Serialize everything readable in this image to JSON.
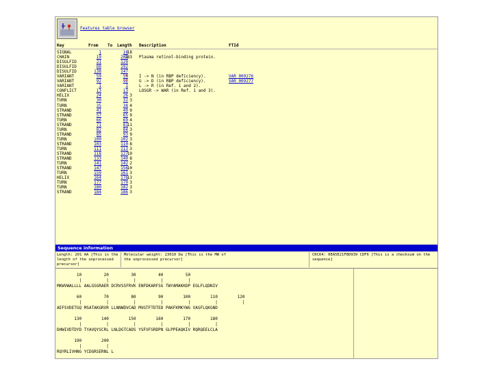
{
  "logo_link": "Features table browser",
  "feature_table": {
    "headers": {
      "key": "Key",
      "from": "From",
      "to": "To",
      "length": "Length",
      "description": "Description",
      "fid": "FTId"
    },
    "rows": [
      {
        "key": "SIGNAL",
        "from": "1",
        "to": "18",
        "length": "18",
        "star": "",
        "desc": "",
        "fid": ""
      },
      {
        "key": "CHAIN",
        "from": "19",
        "to": "201",
        "length": "183",
        "star": "",
        "desc": "Plasma retinol-binding protein.",
        "fid": ""
      },
      {
        "key": "DISULFID",
        "from": "21",
        "to": "129",
        "length": "",
        "star": "",
        "desc": "",
        "fid": ""
      },
      {
        "key": "DISULFID",
        "from": "88",
        "to": "192",
        "length": "",
        "star": "",
        "desc": "",
        "fid": ""
      },
      {
        "key": "DISULFID",
        "from": "138",
        "to": "147",
        "length": "",
        "star": "",
        "desc": "",
        "fid": ""
      },
      {
        "key": "VARIANT",
        "from": "59",
        "to": "59",
        "length": "",
        "star": "*",
        "desc": "I -> N (in RBP deficiency).",
        "fid": "VAR_009276"
      },
      {
        "key": "VARIANT",
        "from": "92",
        "to": "92",
        "length": "",
        "star": "*",
        "desc": "G -> D (in RBP deficiency).",
        "fid": "VAR_009277"
      },
      {
        "key": "VARIANT",
        "from": "1",
        "to": "1",
        "length": "",
        "star": "",
        "desc": "L -> R (in Ref. 1 and 2).",
        "fid": ""
      },
      {
        "key": "CONFLICT",
        "from": "13",
        "to": "13",
        "length": "",
        "star": "",
        "desc": "LOSGR -> WAR (in Ref. 1 and 3).",
        "fid": ""
      },
      {
        "key": "HELIX",
        "from": "24",
        "to": "26",
        "length": "3",
        "star": "",
        "desc": "",
        "fid": ""
      },
      {
        "key": "TURN",
        "from": "30",
        "to": "32",
        "length": "3",
        "star": "",
        "desc": "",
        "fid": ""
      },
      {
        "key": "TURN",
        "from": "35",
        "to": "38",
        "length": "4",
        "star": "",
        "desc": "",
        "fid": ""
      },
      {
        "key": "STRAND",
        "from": "41",
        "to": "49",
        "length": "9",
        "star": "",
        "desc": "",
        "fid": ""
      },
      {
        "key": "STRAND",
        "from": "57",
        "to": "65",
        "length": "9",
        "star": "",
        "desc": "",
        "fid": ""
      },
      {
        "key": "TURN",
        "from": "66",
        "to": "69",
        "length": "4",
        "star": "",
        "desc": "",
        "fid": ""
      },
      {
        "key": "STRAND",
        "from": "71",
        "to": "81",
        "length": "11",
        "star": "",
        "desc": "",
        "fid": ""
      },
      {
        "key": "TURN",
        "from": "82",
        "to": "84",
        "length": "3",
        "star": "",
        "desc": "",
        "fid": ""
      },
      {
        "key": "STRAND",
        "from": "85",
        "to": "93",
        "length": "9",
        "star": "",
        "desc": "",
        "fid": ""
      },
      {
        "key": "TURN",
        "from": "100",
        "to": "102",
        "length": "3",
        "star": "",
        "desc": "",
        "fid": ""
      },
      {
        "key": "STRAND",
        "from": "103",
        "to": "110",
        "length": "8",
        "star": "",
        "desc": "",
        "fid": ""
      },
      {
        "key": "TURN",
        "from": "111",
        "to": "113",
        "length": "3",
        "star": "",
        "desc": "",
        "fid": ""
      },
      {
        "key": "STRAND",
        "from": "118",
        "to": "127",
        "length": "10",
        "star": "",
        "desc": "",
        "fid": ""
      },
      {
        "key": "STRAND",
        "from": "133",
        "to": "140",
        "length": "8",
        "star": "",
        "desc": "",
        "fid": ""
      },
      {
        "key": "TURN",
        "from": "141",
        "to": "142",
        "length": "2",
        "star": "",
        "desc": "",
        "fid": ""
      },
      {
        "key": "STRAND",
        "from": "147",
        "to": "156",
        "length": "10",
        "star": "",
        "desc": "",
        "fid": ""
      },
      {
        "key": "TURN",
        "from": "159",
        "to": "161",
        "length": "3",
        "star": "",
        "desc": "",
        "fid": ""
      },
      {
        "key": "HELIX",
        "from": "164",
        "to": "176",
        "length": "13",
        "star": "",
        "desc": "",
        "fid": ""
      },
      {
        "key": "TURN",
        "from": "177",
        "to": "179",
        "length": "3",
        "star": "",
        "desc": "",
        "fid": ""
      },
      {
        "key": "TURN",
        "from": "180",
        "to": "182",
        "length": "3",
        "star": "",
        "desc": "",
        "fid": ""
      },
      {
        "key": "STRAND",
        "from": "184",
        "to": "186",
        "length": "3",
        "star": "",
        "desc": "",
        "fid": ""
      }
    ]
  },
  "sequence_bar": "Sequence information",
  "sequence_info": {
    "length": "Length: 201 AA [This is the length of the unprocessed precursor]",
    "weight": "Molecular weight: 23010 Da [This is the MW of the unprocessed precursor]",
    "crc": "CRC64: 0EA5E21F8D939 CDF6 [This is a checksum on the sequence]"
  },
  "sequence_lines": [
    "        10         20         30         40         50",
    "         |          |          |          |          |",
    "MKWVWALLLL AALGSGRAER DCRVSSFRVK ENFDKARFSG TWYAMAKKDP EGLFLQDNIV",
    "",
    "        60         70         80         90        100        110        120",
    "         |          |          |          |          |          |          |",
    "AEFSVDETGQ MSATAKGRVR LLNNWDVCAD MVGTFTDTED PAKFKMKYWG VASFLQKGND",
    "",
    "       130        140        150        160        170        180",
    "         |          |          |          |          |          |",
    "DHWIVDTDYD TYAVQYSCRL LNLDGTCADS YSFVFSRDPN GLPPEAQKIV RQRQEELCLA",
    "",
    "       190        200",
    "         |          |",
    "RQYRLIVHNG YCDGRSERNL L"
  ]
}
